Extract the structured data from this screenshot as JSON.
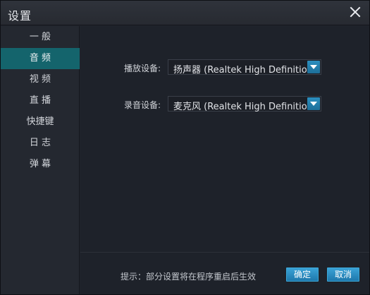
{
  "window": {
    "title": "设置"
  },
  "sidebar": {
    "items": [
      {
        "label": "一 般"
      },
      {
        "label": "音 频"
      },
      {
        "label": "视 频"
      },
      {
        "label": "直 播"
      },
      {
        "label": "快捷键"
      },
      {
        "label": "日 志"
      },
      {
        "label": "弹 幕"
      }
    ],
    "active_index": 1
  },
  "audio": {
    "playback_label": "播放设备:",
    "playback_value": "扬声器 (Realtek High Definitio...",
    "record_label": "录音设备:",
    "record_value": "麦克风 (Realtek High Definitio..."
  },
  "footer": {
    "hint": "提示：部分设置将在程序重启后生效",
    "ok_label": "确定",
    "cancel_label": "取消"
  },
  "colors": {
    "accent": "#14646c",
    "button": "#2a8cc4"
  }
}
